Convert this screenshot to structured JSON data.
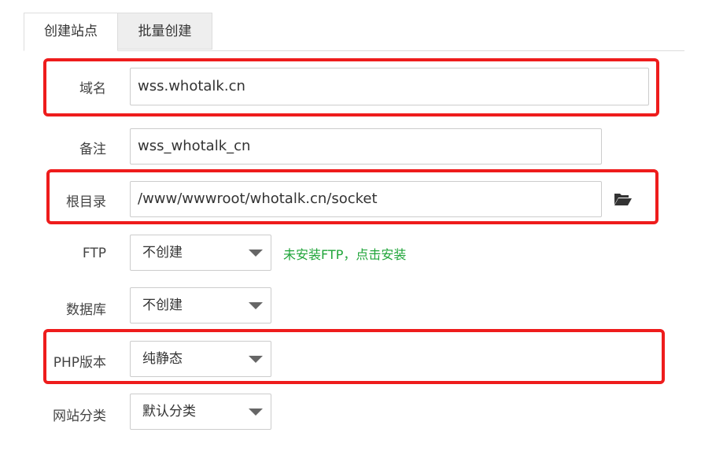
{
  "tabs": [
    {
      "label": "创建站点",
      "active": true
    },
    {
      "label": "批量创建",
      "active": false
    }
  ],
  "form": {
    "domain": {
      "label": "域名",
      "value": "wss.whotalk.cn"
    },
    "remark": {
      "label": "备注",
      "value": "wss_whotalk_cn"
    },
    "root": {
      "label": "根目录",
      "value": "/www/wwwroot/whotalk.cn/socket",
      "icon": "folder-open-icon"
    },
    "ftp": {
      "label": "FTP",
      "selected": "不创建",
      "tip": "未安装FTP，点击安装"
    },
    "database": {
      "label": "数据库",
      "selected": "不创建"
    },
    "php": {
      "label": "PHP版本",
      "selected": "纯静态"
    },
    "category": {
      "label": "网站分类",
      "selected": "默认分类"
    }
  },
  "colors": {
    "highlight": "#ee1c1c",
    "tip": "#20a53a"
  }
}
